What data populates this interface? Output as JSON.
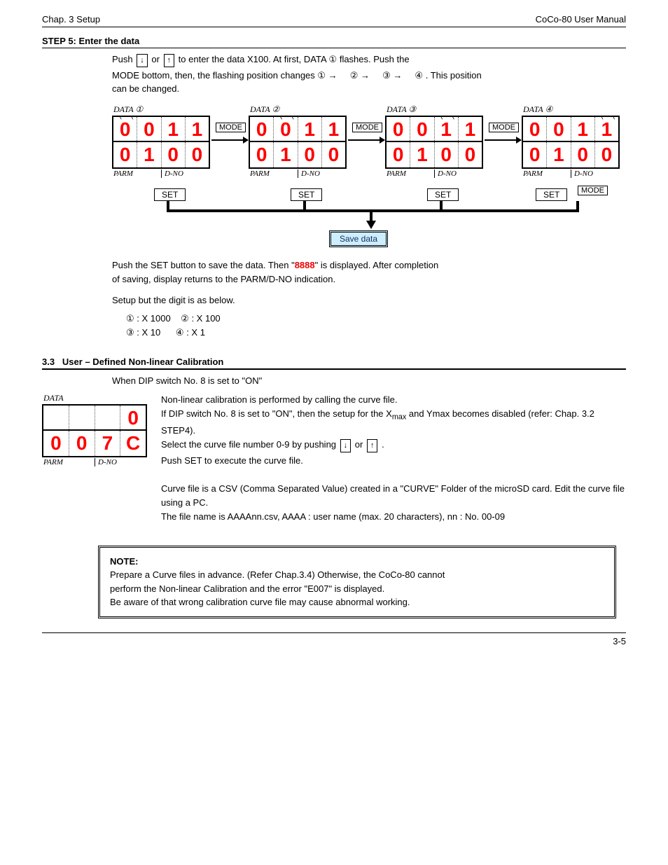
{
  "header": {
    "left": "Chap. 3 Setup",
    "right": "CoCo-80 User Manual"
  },
  "section1": {
    "title": "STEP 5: Enter the data",
    "line1a": "Push ",
    "btn_down": "↓",
    "line1b": " or ",
    "btn_up": "↑",
    "line1c": " to enter the data X100. At first, DATA",
    "circ1": "①",
    "line1d": " flashes. Push the",
    "line2a": "MODE bottom, then, the flashing position changes ",
    "seq": [
      "①",
      "→",
      "②",
      "→",
      "③",
      "→",
      "④"
    ],
    "line2b": ". This position",
    "line3": "can be changed."
  },
  "panels": {
    "labels": [
      "DATA ①",
      "DATA ②",
      "DATA ③",
      "DATA ④"
    ],
    "top": [
      "0",
      "0",
      "1",
      "1"
    ],
    "bottom": [
      "0",
      "1",
      "0",
      "0"
    ],
    "PARM": "PARM",
    "DNO": "D-NO",
    "MODE": "MODE",
    "SET": "SET"
  },
  "save_label": "Save data",
  "middle": {
    "p1a": "Push the SET button to save the data. Then \"",
    "p1b": "\" is displayed. After completion",
    "p1c": "of saving, display returns to the PARM/D-NO indication.",
    "p2a": "Setup but the digit is as below.",
    "map": [
      {
        "c": "①",
        "t": ": X 1000",
        "c2": "②",
        "t2": ": X 100"
      },
      {
        "c": "③",
        "t": ": X 10",
        "c2": "④",
        "t2": ": X 1"
      }
    ]
  },
  "section33": {
    "num": "3.3",
    "title": "User ",
    "title2": "– Defined Non-linear Calibration",
    "text1a": "When DIP switch No.",
    "text1b": "8 is set to \"ON\"",
    "text1c": "Non-linear calibration is performed by calling the curve file.",
    "text2a": "If DIP switch No.",
    "text2b": "8 is set to \"ON\", then the setup for the X",
    "text2c": " and Ymax becomes disabled (refer: Chap. 3.2 STEP4).",
    "text3a": "Select the curve file number 0-9 by pushing ",
    "text3b": " or ",
    "text3c": ".",
    "text4": "Push SET to execute the curve file.",
    "text5a": "Curve file ",
    "text5b": "is a CSV (Comma Separated Value) created in a \"CURVE\" Folder",
    "text5c": " of the microSD card. Edit the curve file using a PC.",
    "text6": "The file name is AAAAnn.csv, AAAA : user name (max. 20 characters), nn : No. 00-09"
  },
  "panel33": {
    "label": "DATA",
    "top": [
      "",
      "",
      "",
      "0"
    ],
    "bottom": [
      "0",
      "0",
      "7",
      "C"
    ],
    "PARM": "PARM",
    "DNO": "D-NO"
  },
  "note": {
    "head": "NOTE:",
    "line1": "Prepare a Curve files in advance. (Refer Chap.3.4) Otherwise, the CoCo-80 cannot",
    "line2": "perform the Non-linear Calibration and the error \"E007\" is displayed.",
    "line3": "Be aware of that wrong calibration curve file may cause abnormal working."
  },
  "footer": {
    "page": "3-5"
  }
}
